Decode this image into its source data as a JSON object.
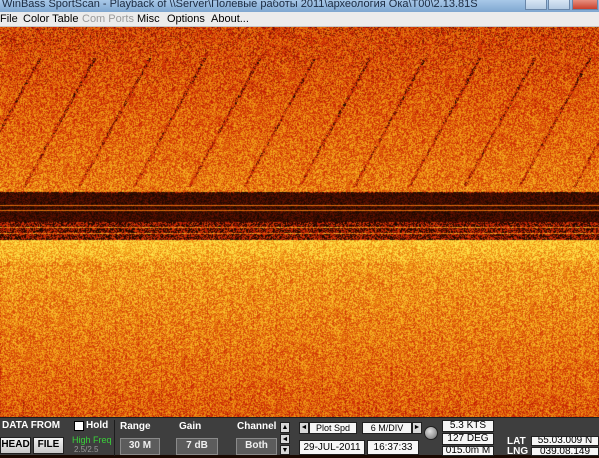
{
  "window": {
    "title": "WinBass SportScan - Playback of \\\\Server\\Полевые работы 2011\\археология Ока\\T00\\2.13.81S"
  },
  "menu": {
    "items": [
      {
        "label": "File",
        "enabled": true
      },
      {
        "label": "Color Table",
        "enabled": true
      },
      {
        "label": "Com Ports",
        "enabled": false
      },
      {
        "label": "Misc",
        "enabled": true
      },
      {
        "label": "Options",
        "enabled": true
      },
      {
        "label": "About...",
        "enabled": true
      }
    ]
  },
  "sonar": {
    "palette": [
      "#1a0800",
      "#c81e04",
      "#e0620a",
      "#f4a41a",
      "#ffe34a"
    ]
  },
  "controls": {
    "data_from_label": "DATA FROM",
    "head_button": "HEAD",
    "file_button": "FILE",
    "hold_label": "Hold",
    "high_freq_label": "High Freq",
    "freq_value": "2.5/2.5",
    "range_label": "Range",
    "range_value": "30 M",
    "gain_label": "Gain",
    "gain_value": "7 dB",
    "channel_label": "Channel",
    "channel_value": "Both",
    "plot_mode": "Plot Spd",
    "scale_value": "6 M/DIV",
    "date": "29-JUL-2011",
    "time": "16:37:33",
    "speed": "5.3 KTS",
    "heading": "127 DEG",
    "depth": "015.0m M",
    "lat_label": "LAT",
    "lng_label": "LNG",
    "lat_value": "55.03.009 N",
    "lng_value": "039.08.149"
  }
}
